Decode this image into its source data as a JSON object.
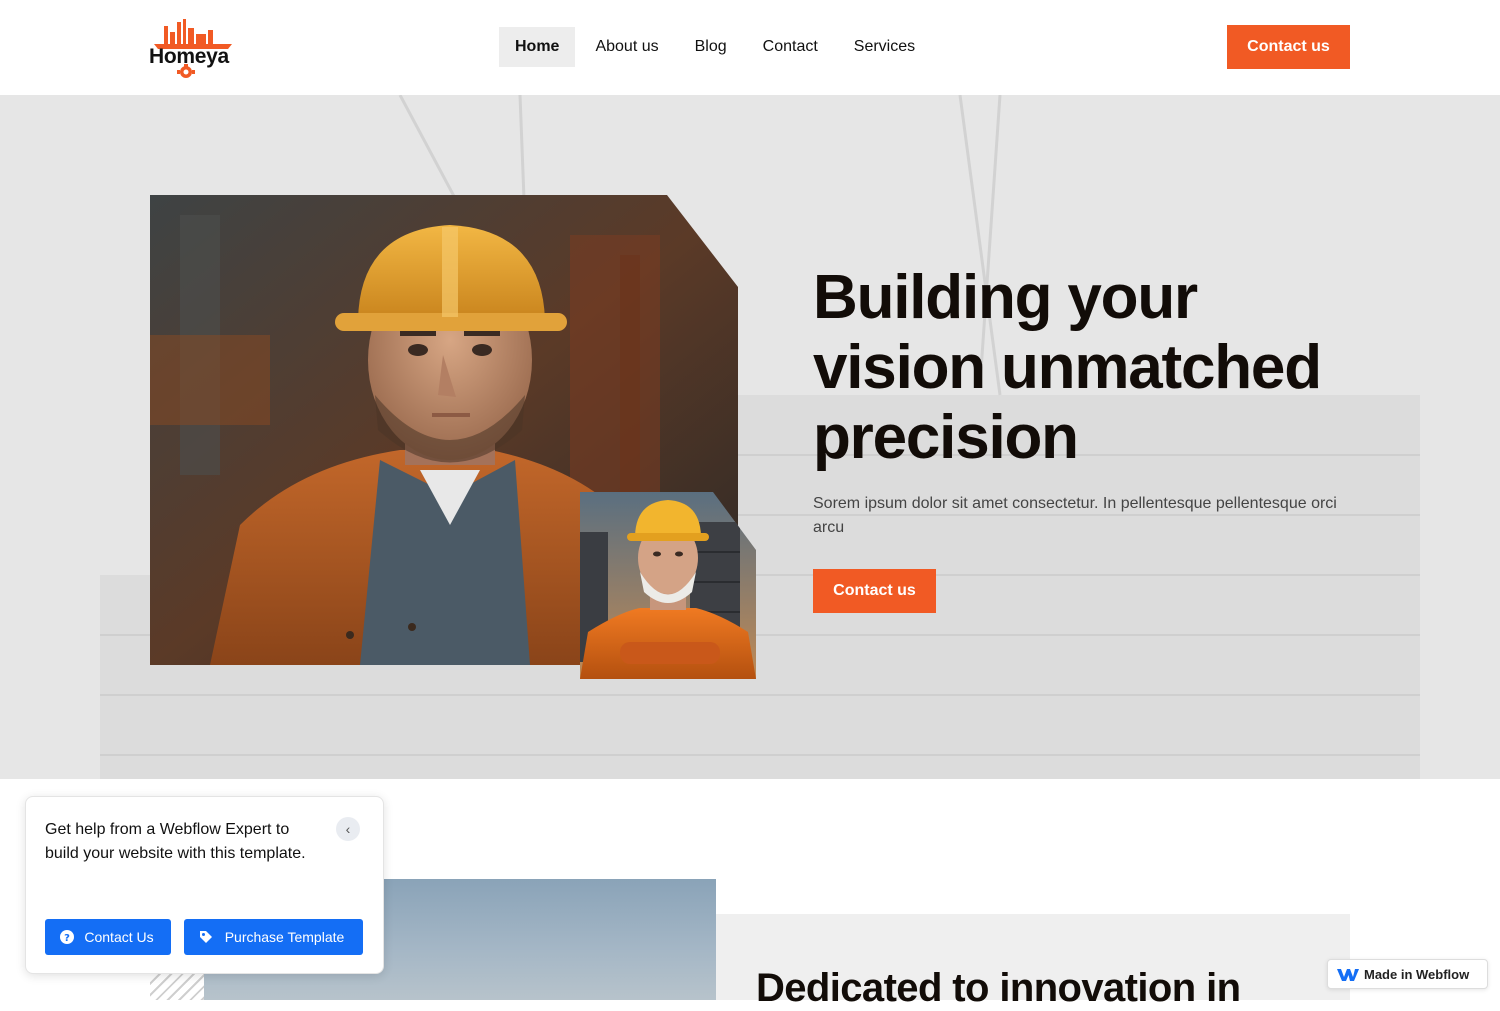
{
  "header": {
    "logo_text": "Homeya",
    "nav": [
      {
        "label": "Home"
      },
      {
        "label": "About us"
      },
      {
        "label": "Blog"
      },
      {
        "label": "Contact"
      },
      {
        "label": "Services"
      }
    ],
    "cta_label": "Contact us"
  },
  "hero": {
    "title": "Building your vision unmatched precision",
    "subtitle": "Sorem ipsum dolor sit amet consectetur. In pellentesque pellentesque orci arcu",
    "cta_label": "Contact us"
  },
  "lower": {
    "title": "Dedicated to innovation in"
  },
  "help_popup": {
    "text": "Get help from a Webflow Expert to build your website with this template.",
    "contact_label": "Contact Us",
    "purchase_label": "Purchase Template"
  },
  "badge": {
    "label": "Made in Webflow"
  },
  "colors": {
    "accent": "#f15a24",
    "webflow_blue": "#146ef5",
    "hero_bg": "#e6e6e6"
  }
}
